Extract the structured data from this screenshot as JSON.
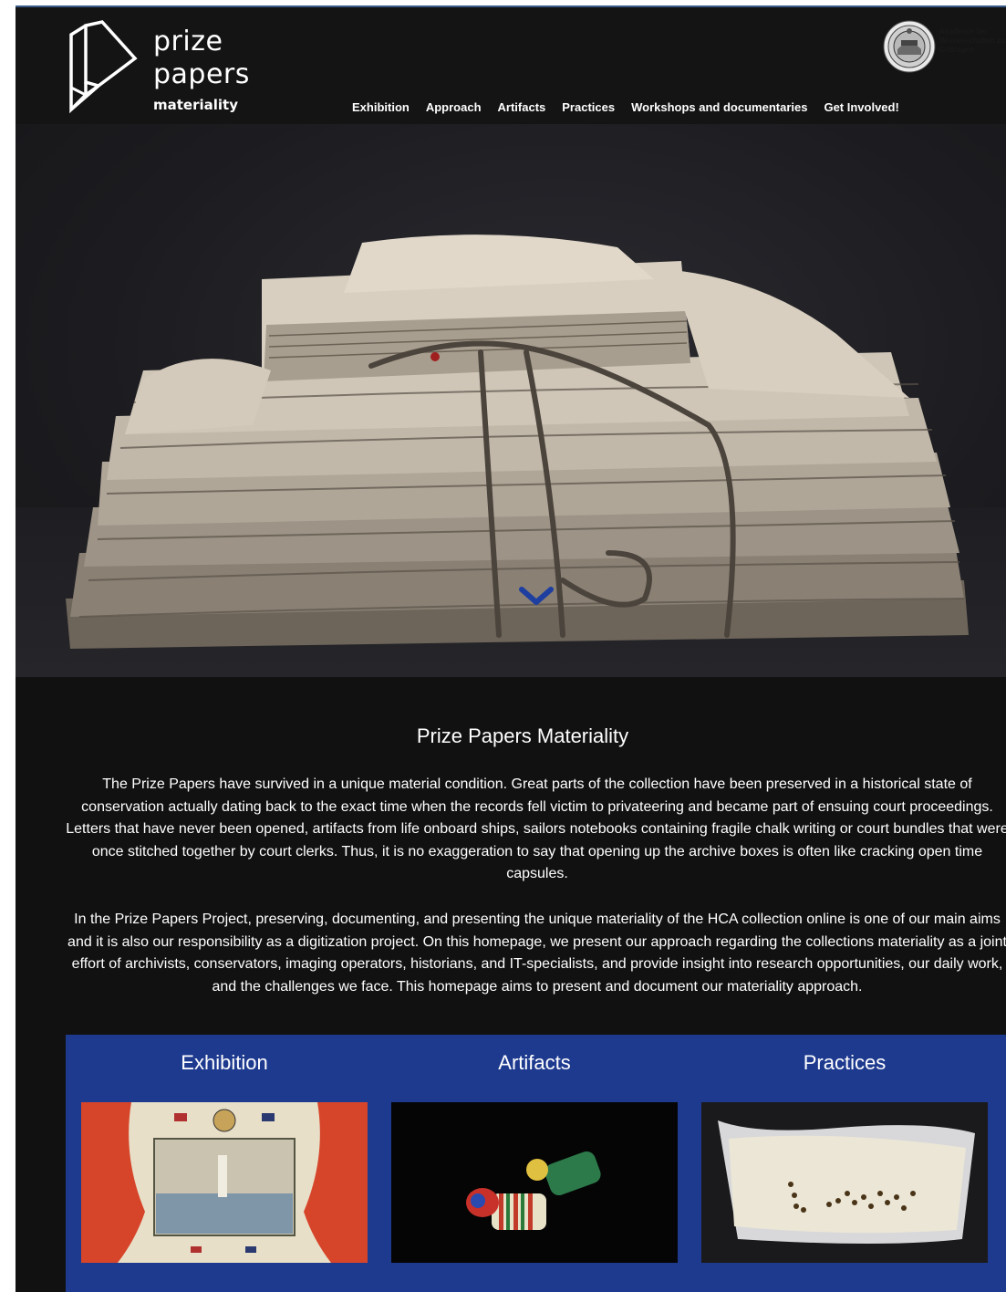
{
  "header": {
    "logo": {
      "word1": "prize",
      "word2": "papers",
      "sub": "materiality",
      "icon": "folded-paper-icon"
    },
    "seal": {
      "icon": "academy-seal-icon",
      "text": "Akademie der Wissenschaften zu Göttingen"
    },
    "nav": [
      {
        "label": "Exhibition"
      },
      {
        "label": "Approach"
      },
      {
        "label": "Artifacts"
      },
      {
        "label": "Practices"
      },
      {
        "label": "Workshops and documentaries"
      },
      {
        "label": "Get Involved!"
      }
    ]
  },
  "hero": {
    "image": "stack-of-old-papers-image",
    "scroll_icon": "chevron-down-icon"
  },
  "intro": {
    "title": "Prize Papers Materiality",
    "paragraph1": "The Prize Papers have survived in a unique material condition. Great parts of the collection have been preserved in a historical state of conservation actually dating back to the exact time when the records fell victim to privateering and became part of ensuing court proceedings. Letters that have never been opened, artifacts from life onboard ships, sailors notebooks containing fragile chalk writing or court bundles that were once stitched together by court clerks. Thus, it is no exaggeration to say that opening up the archive boxes is often like cracking open time capsules.",
    "paragraph2": "In the Prize Papers Project, preserving, documenting, and presenting the unique materiality of the HCA collection online is one of our main aims and it is also our responsibility as a digitization project. On this homepage, we present our approach regarding the collections materiality as a joint effort of archivists, conservators, imaging operators, historians, and IT-specialists, and provide insight into research opportunities, our daily work, and the challenges we face. This homepage aims to present and document our materiality approach."
  },
  "cards": [
    {
      "title": "Exhibition",
      "image": "lighthouse-painting-image"
    },
    {
      "title": "Artifacts",
      "image": "striped-beads-image"
    },
    {
      "title": "Practices",
      "image": "seeds-in-paper-image"
    }
  ],
  "colors": {
    "background": "#111111",
    "header": "#141414",
    "card_band": "#1e3a8f",
    "chevron": "#1f3fa0",
    "text": "#ffffff"
  }
}
